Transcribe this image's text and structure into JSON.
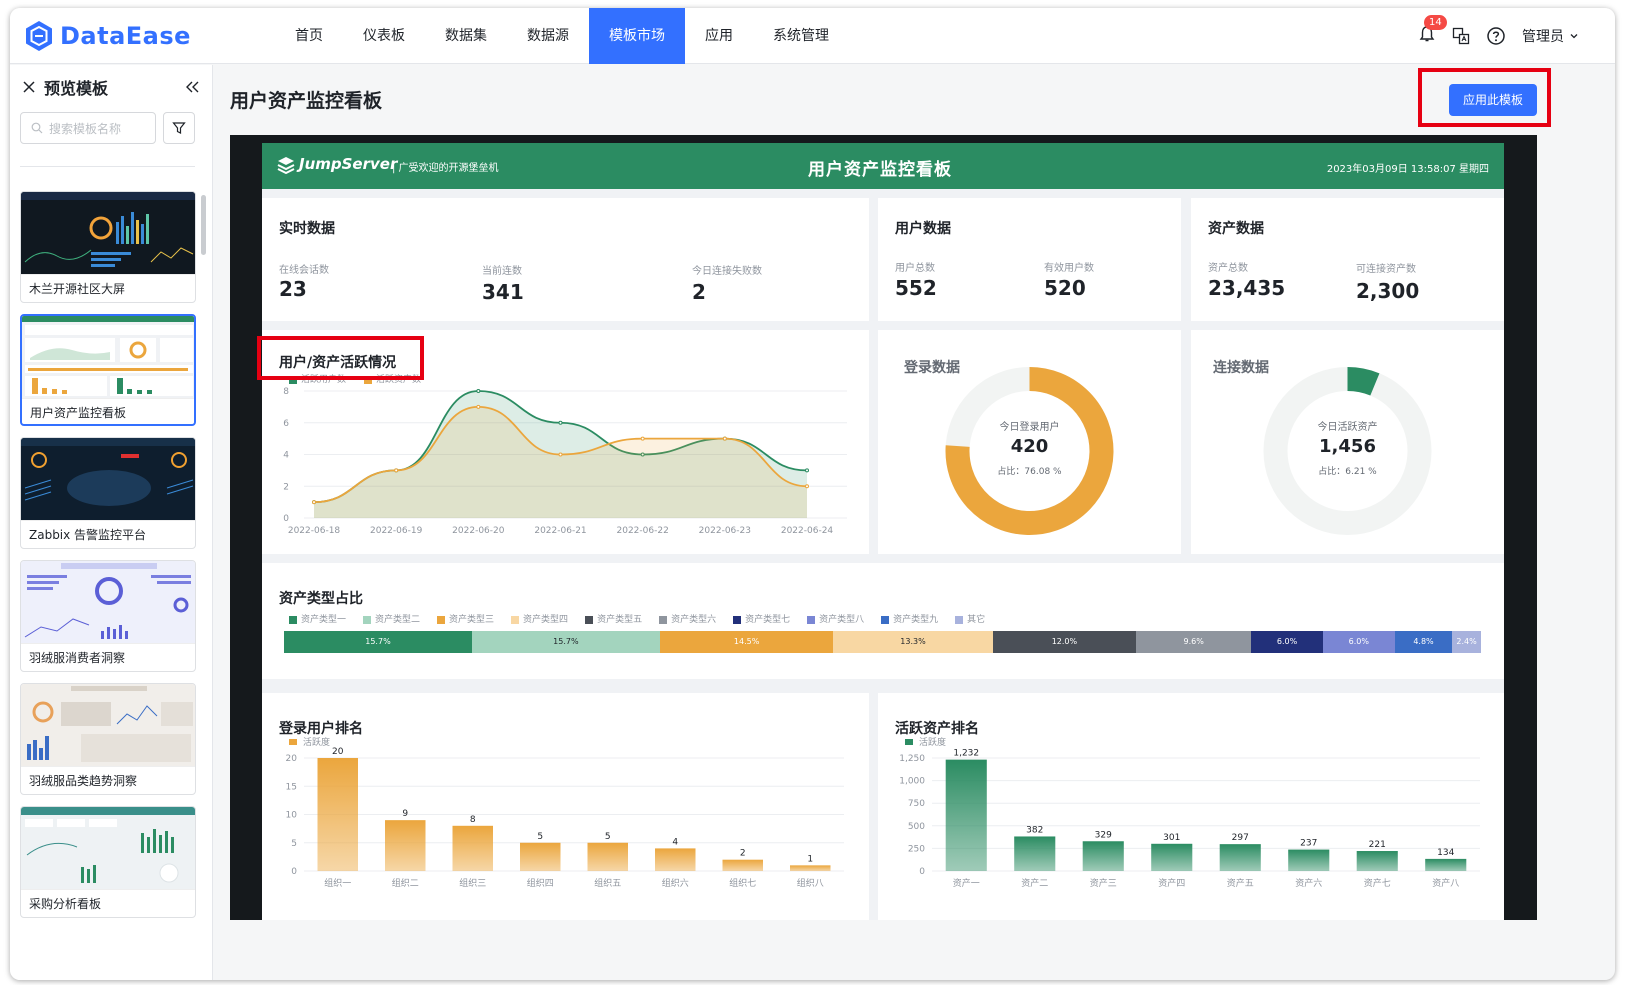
{
  "app": {
    "logo": "DataEase"
  },
  "nav": [
    "首页",
    "仪表板",
    "数据集",
    "数据源",
    "模板市场",
    "应用",
    "系统管理"
  ],
  "topright": {
    "badge": "14",
    "user": "管理员"
  },
  "sidebar": {
    "title": "预览模板",
    "search_placeholder": "搜索模板名称",
    "templates": [
      {
        "name": "木兰开源社区大屏"
      },
      {
        "name": "用户资产监控看板"
      },
      {
        "name": "Zabbix 告警监控平台"
      },
      {
        "name": "羽绒服消费者洞察"
      },
      {
        "name": "羽绒服品类趋势洞察"
      },
      {
        "name": "采购分析看板"
      }
    ]
  },
  "main": {
    "title": "用户资产监控看板",
    "apply_label": "应用此模板"
  },
  "dashboard": {
    "brand": "JumpServer",
    "slogan": "| 广受欢迎的开源堡垒机",
    "title": "用户资产监控看板",
    "datetime": "2023年03月09日 13:58:07 星期四",
    "realtime": {
      "title": "实时数据",
      "items": [
        {
          "label": "在线会话数",
          "value": "23"
        },
        {
          "label": "当前连数",
          "value": "341"
        },
        {
          "label": "今日连接失败数",
          "value": "2"
        }
      ]
    },
    "users": {
      "title": "用户数据",
      "items": [
        {
          "label": "用户总数",
          "value": "552"
        },
        {
          "label": "有效用户数",
          "value": "520"
        }
      ]
    },
    "assets": {
      "title": "资产数据",
      "items": [
        {
          "label": "资产总数",
          "value": "23,435"
        },
        {
          "label": "可连接资产数",
          "value": "2,300"
        }
      ]
    },
    "activity": {
      "title": "用户/资产活跃情况",
      "legend": [
        "活跃用户数",
        "活跃资产数"
      ]
    },
    "login": {
      "title": "登录数据",
      "center_label": "今日登录用户",
      "center_value": "420",
      "ratio": "占比：76.08 %",
      "fraction": 0.7608
    },
    "connect": {
      "title": "连接数据",
      "center_label": "今日活跃资产",
      "center_value": "1,456",
      "ratio": "占比：6.21 %",
      "fraction": 0.0621
    },
    "asset_type": {
      "title": "资产类型占比"
    },
    "login_rank": {
      "title": "登录用户排名",
      "legend": "活跃度"
    },
    "asset_rank": {
      "title": "活跃资产排名",
      "legend": "活跃度"
    }
  },
  "colors": {
    "accent": "#3370ff",
    "green": "#2b8c62",
    "orange": "#eba63d"
  },
  "chart_data": [
    {
      "type": "area",
      "title": "用户/资产活跃情况",
      "x": [
        "2022-06-18",
        "2022-06-19",
        "2022-06-20",
        "2022-06-21",
        "2022-06-22",
        "2022-06-23",
        "2022-06-24"
      ],
      "ylim": [
        0,
        8
      ],
      "yticks": [
        0,
        2,
        4,
        6,
        8
      ],
      "series": [
        {
          "name": "活跃用户数",
          "color": "#2b8c62",
          "values": [
            1,
            3,
            8,
            6,
            4,
            5,
            3
          ]
        },
        {
          "name": "活跃资产数",
          "color": "#eba63d",
          "values": [
            1,
            3,
            7,
            4,
            5,
            5,
            2
          ]
        }
      ]
    },
    {
      "type": "bar",
      "title": "资产类型占比",
      "categories": [
        "资产类型一",
        "资产类型二",
        "资产类型三",
        "资产类型四",
        "资产类型五",
        "资产类型六",
        "资产类型七",
        "资产类型八",
        "资产类型九",
        "其它"
      ],
      "values": [
        15.7,
        15.7,
        14.5,
        13.3,
        12.0,
        9.6,
        6.0,
        6.0,
        4.8,
        2.4
      ],
      "labels": [
        "15.7%",
        "15.7%",
        "14.5%",
        "13.3%",
        "12.0%",
        "9.6%",
        "6.0%",
        "6.0%",
        "4.8%",
        "2.4%"
      ],
      "colors": [
        "#2b8c62",
        "#a3d4be",
        "#eba63d",
        "#f8d7a3",
        "#4a4f57",
        "#8f959e",
        "#22307a",
        "#7a86d4",
        "#3a6dc5",
        "#a8b2dd"
      ]
    },
    {
      "type": "bar",
      "title": "登录用户排名",
      "series": [
        {
          "name": "活跃度"
        }
      ],
      "categories": [
        "组织一",
        "组织二",
        "组织三",
        "组织四",
        "组织五",
        "组织六",
        "组织七",
        "组织八"
      ],
      "values": [
        20,
        9,
        8,
        5,
        5,
        4,
        2,
        1
      ],
      "ylim": [
        0,
        20
      ],
      "yticks": [
        0,
        5,
        10,
        15,
        20
      ]
    },
    {
      "type": "bar",
      "title": "活跃资产排名",
      "series": [
        {
          "name": "活跃度"
        }
      ],
      "categories": [
        "资产一",
        "资产二",
        "资产三",
        "资产四",
        "资产五",
        "资产六",
        "资产七",
        "资产八"
      ],
      "values": [
        1232,
        382,
        329,
        301,
        297,
        237,
        221,
        134
      ],
      "labels": [
        "1,232",
        "382",
        "329",
        "301",
        "297",
        "237",
        "221",
        "134"
      ],
      "ylim": [
        0,
        1250
      ],
      "yticks": [
        0,
        250,
        500,
        750,
        1000,
        1250
      ],
      "ytick_labels": [
        "0",
        "250",
        "500",
        "750",
        "1,000",
        "1,250"
      ]
    }
  ]
}
